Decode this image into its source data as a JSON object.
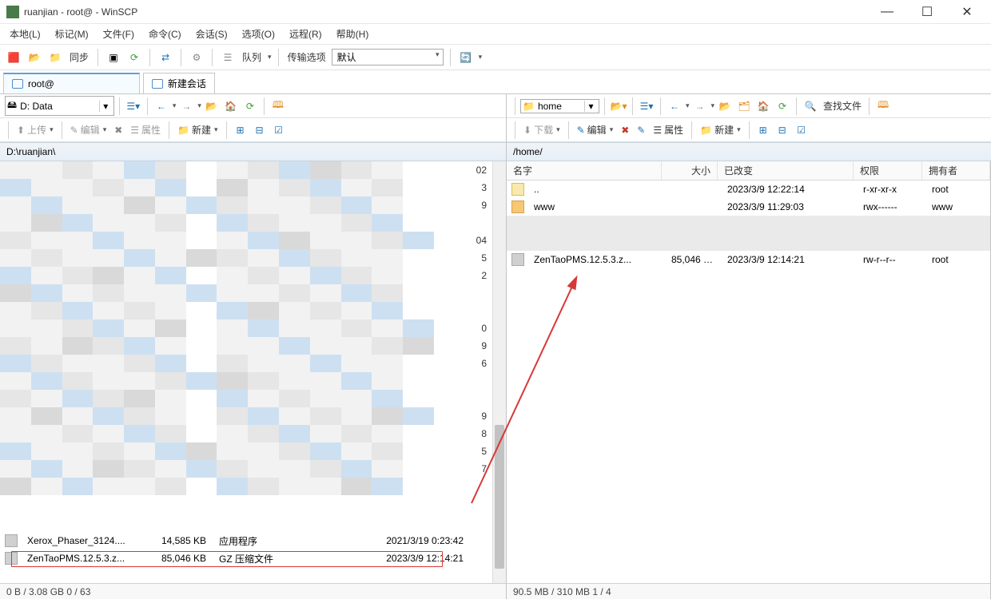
{
  "title": "ruanjian - root@                  - WinSCP",
  "menubar": [
    "本地(L)",
    "标记(M)",
    "文件(F)",
    "命令(C)",
    "会话(S)",
    "选项(O)",
    "远程(R)",
    "帮助(H)"
  ],
  "toolbar1": {
    "sync_label": "同步",
    "queue_label": "队列",
    "transfer_label": "传输选项",
    "transfer_value": "默认"
  },
  "session": {
    "active_tab": "root@",
    "new_tab": "新建会话"
  },
  "left": {
    "drive_label": "D: Data",
    "upload": "上传",
    "edit": "编辑",
    "props": "属性",
    "newbtn": "新建",
    "path": "D:\\ruanjian\\",
    "rows_suffix": [
      "02",
      "3",
      "9",
      "",
      "04",
      "5",
      "2",
      "",
      "",
      "0",
      "9",
      "6",
      "",
      "",
      "9",
      "8",
      "5",
      "7"
    ],
    "bottom": [
      {
        "name": "Xerox_Phaser_3124....",
        "size": "14,585 KB",
        "type": "应用程序",
        "date": "2021/3/19  0:23:42"
      },
      {
        "name": "ZenTaoPMS.12.5.3.z...",
        "size": "85,046 KB",
        "type": "GZ 压缩文件",
        "date": "2023/3/9  12:14:21"
      }
    ],
    "status": "0 B / 3.08 GB    0 / 63"
  },
  "right": {
    "drive_label": "home",
    "download": "下载",
    "edit": "编辑",
    "props": "属性",
    "newbtn": "新建",
    "find_label": "查找文件",
    "path": "/home/",
    "cols": {
      "name": "名字",
      "size": "大小",
      "changed": "已改变",
      "rights": "权限",
      "owner": "拥有者"
    },
    "rows": [
      {
        "name": "..",
        "size": "",
        "changed": "2023/3/9 12:22:14",
        "rights": "r-xr-xr-x",
        "owner": "root",
        "icon": "up"
      },
      {
        "name": "www",
        "size": "",
        "changed": "2023/3/9 11:29:03",
        "rights": "rwx------",
        "owner": "www",
        "icon": "folder"
      },
      {
        "name": "",
        "size": "",
        "changed": "",
        "rights": "",
        "owner": "",
        "icon": "blurred"
      },
      {
        "name": "ZenTaoPMS.12.5.3.z...",
        "size": "85,046 KB",
        "changed": "2023/3/9 12:14:21",
        "rights": "rw-r--r--",
        "owner": "root",
        "icon": "file"
      }
    ],
    "status": "90.5 MB / 310 MB    1 / 4"
  }
}
